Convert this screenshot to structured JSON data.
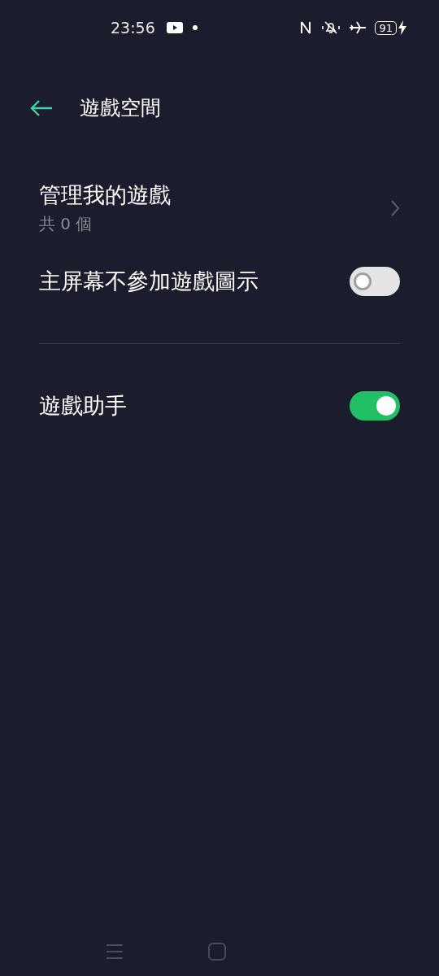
{
  "status_bar": {
    "time": "23:56",
    "battery": "91"
  },
  "header": {
    "title": "遊戲空間"
  },
  "settings": [
    {
      "kind": "link",
      "title": "管理我的遊戲",
      "subtitle": "共 0 個"
    },
    {
      "kind": "toggle",
      "title": "主屏幕不參加遊戲圖示",
      "on": false
    },
    {
      "kind": "divider"
    },
    {
      "kind": "toggle",
      "title": "遊戲助手",
      "on": true
    }
  ]
}
